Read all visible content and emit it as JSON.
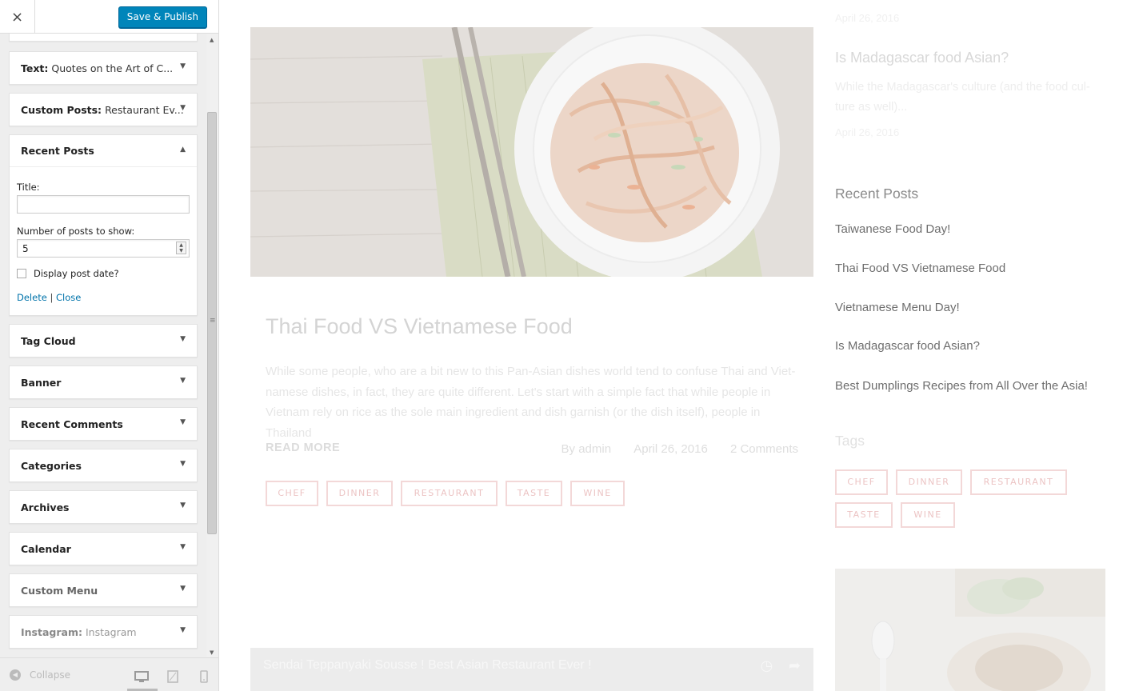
{
  "header": {
    "close_label": "×",
    "save_label": "Save & Publish"
  },
  "widgets": {
    "text": {
      "name": "Text:",
      "sub": "Quotes on the Art of C..."
    },
    "custom_posts": {
      "name": "Custom Posts:",
      "sub": "Restaurant Ev..."
    },
    "recent_posts": {
      "name": "Recent Posts",
      "title_label": "Title:",
      "title_value": "",
      "number_label": "Number of posts to show:",
      "number_value": "5",
      "display_date_label": "Display post date?",
      "delete_label": "Delete",
      "separator": "|",
      "close_label": "Close"
    },
    "tag_cloud": {
      "name": "Tag Cloud"
    },
    "banner": {
      "name": "Banner"
    },
    "recent_comments": {
      "name": "Recent Comments"
    },
    "categories": {
      "name": "Categories"
    },
    "archives": {
      "name": "Archives"
    },
    "calendar": {
      "name": "Calendar"
    },
    "custom_menu": {
      "name": "Custom Menu"
    },
    "instagram": {
      "name": "Instagram:",
      "sub": "Instagram"
    }
  },
  "footer": {
    "collapse_label": "Collapse"
  },
  "preview": {
    "post": {
      "title": "Thai Food VS Vietnamese Food",
      "excerpt": "While some people, who are a bit new to this Pan-Asian dishes world tend to confuse Thai and Viet-namese dishes, in fact, they are quite different. Let's start with a simple fact that while people in Vietnam rely on rice as the sole main ingredient and dish garnish (or the dish itself), people in Thailand",
      "read_more": "READ MORE",
      "author": "By admin",
      "date": "April 26, 2016",
      "comments": "2 Comments",
      "tags": [
        "CHEF",
        "DINNER",
        "RESTAURANT",
        "TASTE",
        "WINE"
      ]
    },
    "video_title": "Sendai Teppanyaki Sousse ! Best Asian Restaurant Ever !",
    "right": {
      "top_date": "April 26, 2016",
      "post_title": "Is Madagascar food Asian?",
      "post_excerpt": "While the Madagascar's culture (and the food cul-ture as well)...",
      "post_date": "April 26, 2016",
      "recent_posts_heading": "Recent Posts",
      "recent_posts": [
        "Taiwanese Food Day!",
        "Thai Food VS Vietnamese Food",
        "Vietnamese Menu Day!",
        "Is Madagascar food Asian?",
        "Best Dumplings Recipes from All Over the Asia!"
      ],
      "tags_heading": "Tags",
      "tags": [
        "CHEF",
        "DINNER",
        "RESTAURANT",
        "TASTE",
        "WINE"
      ]
    }
  },
  "icons": {
    "close": "close-icon",
    "collapse": "collapse-icon",
    "desktop": "desktop-icon",
    "tablet": "tablet-icon",
    "mobile": "mobile-icon",
    "clock": "clock-icon",
    "share": "share-icon"
  },
  "colors": {
    "primary_button": "#0085ba",
    "link": "#0073aa",
    "tag_border": "#f3d8d8"
  }
}
